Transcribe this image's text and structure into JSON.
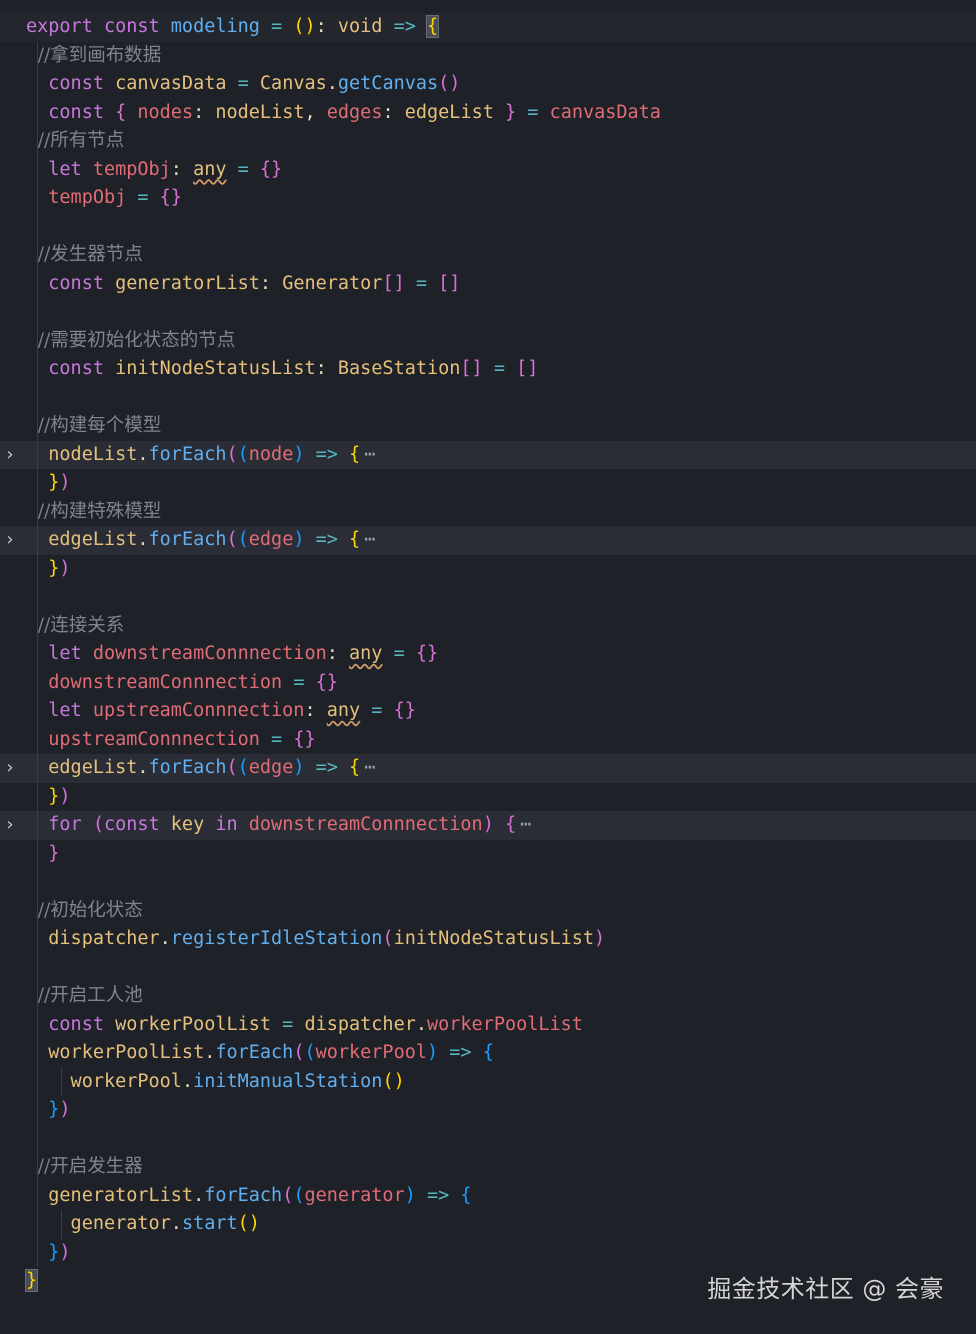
{
  "code": {
    "lines": [
      {
        "fold": false,
        "guides": 0,
        "tokens": [
          [
            "kw",
            "export "
          ],
          [
            "kw",
            "const "
          ],
          [
            "fn",
            "modeling"
          ],
          [
            "op",
            " = "
          ],
          [
            "br3",
            "("
          ],
          [
            "br3",
            ")"
          ],
          [
            "plain",
            ": "
          ],
          [
            "type",
            "void"
          ],
          [
            "op",
            " => "
          ],
          [
            "hlbrace",
            "{"
          ]
        ]
      },
      {
        "fold": false,
        "guides": 1,
        "tokens": [
          [
            "com",
            "  //拿到画布数据"
          ]
        ]
      },
      {
        "fold": false,
        "guides": 1,
        "tokens": [
          [
            "kw",
            "  const "
          ],
          [
            "type",
            "canvasData"
          ],
          [
            "op",
            " = "
          ],
          [
            "type",
            "Canvas"
          ],
          [
            "plain",
            "."
          ],
          [
            "fn",
            "getCanvas"
          ],
          [
            "br",
            "()"
          ]
        ]
      },
      {
        "fold": false,
        "guides": 1,
        "tokens": [
          [
            "kw",
            "  const "
          ],
          [
            "br",
            "{ "
          ],
          [
            "var",
            "nodes"
          ],
          [
            "plain",
            ": "
          ],
          [
            "type",
            "nodeList"
          ],
          [
            "plain",
            ", "
          ],
          [
            "var",
            "edges"
          ],
          [
            "plain",
            ": "
          ],
          [
            "type",
            "edgeList"
          ],
          [
            "br",
            " }"
          ],
          [
            "op",
            " = "
          ],
          [
            "var",
            "canvasData"
          ]
        ]
      },
      {
        "fold": false,
        "guides": 1,
        "tokens": [
          [
            "com",
            "  //所有节点"
          ]
        ]
      },
      {
        "fold": false,
        "guides": 1,
        "tokens": [
          [
            "kw",
            "  let "
          ],
          [
            "var",
            "tempObj"
          ],
          [
            "plain",
            ": "
          ],
          [
            "any",
            "any"
          ],
          [
            "op",
            " = "
          ],
          [
            "br",
            "{}"
          ]
        ]
      },
      {
        "fold": false,
        "guides": 1,
        "tokens": [
          [
            "var",
            "  tempObj"
          ],
          [
            "op",
            " = "
          ],
          [
            "br",
            "{}"
          ]
        ]
      },
      {
        "fold": false,
        "guides": 1,
        "tokens": []
      },
      {
        "fold": false,
        "guides": 1,
        "tokens": [
          [
            "com",
            "  //发生器节点"
          ]
        ]
      },
      {
        "fold": false,
        "guides": 1,
        "tokens": [
          [
            "kw",
            "  const "
          ],
          [
            "type",
            "generatorList"
          ],
          [
            "plain",
            ": "
          ],
          [
            "type",
            "Generator"
          ],
          [
            "br",
            "[]"
          ],
          [
            "op",
            " = "
          ],
          [
            "br",
            "[]"
          ]
        ]
      },
      {
        "fold": false,
        "guides": 1,
        "tokens": []
      },
      {
        "fold": false,
        "guides": 1,
        "tokens": [
          [
            "com",
            "  //需要初始化状态的节点"
          ]
        ]
      },
      {
        "fold": false,
        "guides": 1,
        "tokens": [
          [
            "kw",
            "  const "
          ],
          [
            "type",
            "initNodeStatusList"
          ],
          [
            "plain",
            ": "
          ],
          [
            "type",
            "BaseStation"
          ],
          [
            "br",
            "[]"
          ],
          [
            "op",
            " = "
          ],
          [
            "br",
            "[]"
          ]
        ]
      },
      {
        "fold": false,
        "guides": 1,
        "tokens": []
      },
      {
        "fold": false,
        "guides": 1,
        "tokens": [
          [
            "com",
            "  //构建每个模型"
          ]
        ]
      },
      {
        "fold": true,
        "guides": 1,
        "tokens": [
          [
            "type",
            "  nodeList"
          ],
          [
            "plain",
            "."
          ],
          [
            "fn",
            "forEach"
          ],
          [
            "br",
            "("
          ],
          [
            "br2",
            "("
          ],
          [
            "var",
            "node"
          ],
          [
            "br2",
            ")"
          ],
          [
            "op",
            " => "
          ],
          [
            "br3",
            "{"
          ],
          [
            "ell",
            "⋯"
          ]
        ]
      },
      {
        "fold": false,
        "guides": 1,
        "tokens": [
          [
            "br3",
            "  }"
          ],
          [
            "br",
            ")"
          ]
        ]
      },
      {
        "fold": false,
        "guides": 1,
        "tokens": [
          [
            "com",
            "  //构建特殊模型"
          ]
        ]
      },
      {
        "fold": true,
        "guides": 1,
        "tokens": [
          [
            "type",
            "  edgeList"
          ],
          [
            "plain",
            "."
          ],
          [
            "fn",
            "forEach"
          ],
          [
            "br",
            "("
          ],
          [
            "br2",
            "("
          ],
          [
            "var",
            "edge"
          ],
          [
            "br2",
            ")"
          ],
          [
            "op",
            " => "
          ],
          [
            "br3",
            "{"
          ],
          [
            "ell",
            "⋯"
          ]
        ]
      },
      {
        "fold": false,
        "guides": 1,
        "tokens": [
          [
            "br3",
            "  }"
          ],
          [
            "br",
            ")"
          ]
        ]
      },
      {
        "fold": false,
        "guides": 1,
        "tokens": []
      },
      {
        "fold": false,
        "guides": 1,
        "tokens": [
          [
            "com",
            "  //连接关系"
          ]
        ]
      },
      {
        "fold": false,
        "guides": 1,
        "tokens": [
          [
            "kw",
            "  let "
          ],
          [
            "var",
            "downstreamConnnection"
          ],
          [
            "plain",
            ": "
          ],
          [
            "any",
            "any"
          ],
          [
            "op",
            " = "
          ],
          [
            "br",
            "{}"
          ]
        ]
      },
      {
        "fold": false,
        "guides": 1,
        "tokens": [
          [
            "var",
            "  downstreamConnnection"
          ],
          [
            "op",
            " = "
          ],
          [
            "br",
            "{}"
          ]
        ]
      },
      {
        "fold": false,
        "guides": 1,
        "tokens": [
          [
            "kw",
            "  let "
          ],
          [
            "var",
            "upstreamConnnection"
          ],
          [
            "plain",
            ": "
          ],
          [
            "any",
            "any"
          ],
          [
            "op",
            " = "
          ],
          [
            "br",
            "{}"
          ]
        ]
      },
      {
        "fold": false,
        "guides": 1,
        "tokens": [
          [
            "var",
            "  upstreamConnnection"
          ],
          [
            "op",
            " = "
          ],
          [
            "br",
            "{}"
          ]
        ]
      },
      {
        "fold": true,
        "guides": 1,
        "tokens": [
          [
            "type",
            "  edgeList"
          ],
          [
            "plain",
            "."
          ],
          [
            "fn",
            "forEach"
          ],
          [
            "br",
            "("
          ],
          [
            "br2",
            "("
          ],
          [
            "var",
            "edge"
          ],
          [
            "br2",
            ")"
          ],
          [
            "op",
            " => "
          ],
          [
            "br3",
            "{"
          ],
          [
            "ell",
            "⋯"
          ]
        ]
      },
      {
        "fold": false,
        "guides": 1,
        "tokens": [
          [
            "br3",
            "  }"
          ],
          [
            "br",
            ")"
          ]
        ]
      },
      {
        "fold": true,
        "guides": 1,
        "tokens": [
          [
            "kw",
            "  for "
          ],
          [
            "br",
            "("
          ],
          [
            "kw",
            "const "
          ],
          [
            "type",
            "key "
          ],
          [
            "kw",
            "in "
          ],
          [
            "var",
            "downstreamConnnection"
          ],
          [
            "br",
            ")"
          ],
          [
            "br",
            " {"
          ],
          [
            "ell",
            "⋯"
          ]
        ]
      },
      {
        "fold": false,
        "guides": 1,
        "tokens": [
          [
            "br",
            "  }"
          ]
        ]
      },
      {
        "fold": false,
        "guides": 1,
        "tokens": []
      },
      {
        "fold": false,
        "guides": 1,
        "tokens": [
          [
            "com",
            "  //初始化状态"
          ]
        ]
      },
      {
        "fold": false,
        "guides": 1,
        "tokens": [
          [
            "type",
            "  dispatcher"
          ],
          [
            "plain",
            "."
          ],
          [
            "fn",
            "registerIdleStation"
          ],
          [
            "br",
            "("
          ],
          [
            "type",
            "initNodeStatusList"
          ],
          [
            "br",
            ")"
          ]
        ]
      },
      {
        "fold": false,
        "guides": 1,
        "tokens": []
      },
      {
        "fold": false,
        "guides": 1,
        "tokens": [
          [
            "com",
            "  //开启工人池"
          ]
        ]
      },
      {
        "fold": false,
        "guides": 1,
        "tokens": [
          [
            "kw",
            "  const "
          ],
          [
            "type",
            "workerPoolList"
          ],
          [
            "op",
            " = "
          ],
          [
            "type",
            "dispatcher"
          ],
          [
            "plain",
            "."
          ],
          [
            "var",
            "workerPoolList"
          ]
        ]
      },
      {
        "fold": false,
        "guides": 1,
        "tokens": [
          [
            "type",
            "  workerPoolList"
          ],
          [
            "plain",
            "."
          ],
          [
            "fn",
            "forEach"
          ],
          [
            "br",
            "("
          ],
          [
            "br2",
            "("
          ],
          [
            "var",
            "workerPool"
          ],
          [
            "br2",
            ")"
          ],
          [
            "op",
            " => "
          ],
          [
            "br2",
            "{"
          ]
        ]
      },
      {
        "fold": false,
        "guides": 2,
        "tokens": [
          [
            "type",
            "    workerPool"
          ],
          [
            "plain",
            "."
          ],
          [
            "fn",
            "initManualStation"
          ],
          [
            "br3",
            "()"
          ]
        ]
      },
      {
        "fold": false,
        "guides": 1,
        "tokens": [
          [
            "br2",
            "  }"
          ],
          [
            "br",
            ")"
          ]
        ]
      },
      {
        "fold": false,
        "guides": 1,
        "tokens": []
      },
      {
        "fold": false,
        "guides": 1,
        "tokens": [
          [
            "com",
            "  //开启发生器"
          ]
        ]
      },
      {
        "fold": false,
        "guides": 1,
        "tokens": [
          [
            "type",
            "  generatorList"
          ],
          [
            "plain",
            "."
          ],
          [
            "fn",
            "forEach"
          ],
          [
            "br",
            "("
          ],
          [
            "br2",
            "("
          ],
          [
            "var",
            "generator"
          ],
          [
            "br2",
            ")"
          ],
          [
            "op",
            " => "
          ],
          [
            "br2",
            "{"
          ]
        ]
      },
      {
        "fold": false,
        "guides": 2,
        "tokens": [
          [
            "type",
            "    generator"
          ],
          [
            "plain",
            "."
          ],
          [
            "fn",
            "start"
          ],
          [
            "br3",
            "()"
          ]
        ]
      },
      {
        "fold": false,
        "guides": 1,
        "tokens": [
          [
            "br2",
            "  }"
          ],
          [
            "br",
            ")"
          ]
        ]
      },
      {
        "fold": false,
        "guides": 0,
        "tokens": [
          [
            "hlbrace",
            "}"
          ]
        ]
      }
    ]
  },
  "watermark": "掘金技术社区 @ 会豪",
  "icons": {
    "fold": "chevron-right-icon"
  }
}
